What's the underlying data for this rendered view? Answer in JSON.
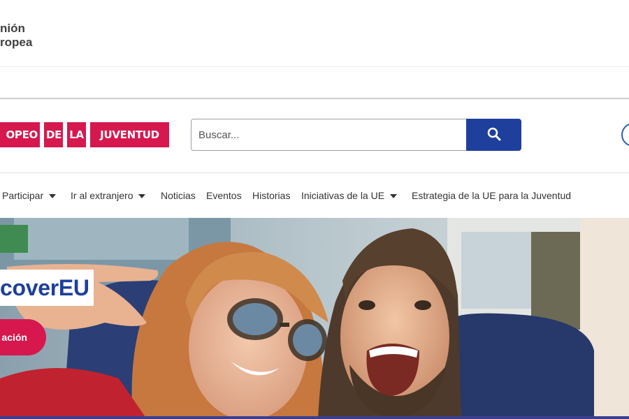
{
  "eu_logo": {
    "line1": "nión",
    "line2": "ropea"
  },
  "brand": {
    "tiles": [
      "OPEO",
      "DE",
      "LA",
      "JUVENTUD"
    ],
    "color": "#d6184e"
  },
  "search": {
    "placeholder": "Buscar...",
    "button_color": "#1e3f9c",
    "icon": "search-icon"
  },
  "nav": {
    "items": [
      {
        "label": "Participar",
        "dropdown": true
      },
      {
        "label": "Ir al extranjero",
        "dropdown": true
      },
      {
        "label": "Noticias",
        "dropdown": false
      },
      {
        "label": "Eventos",
        "dropdown": false
      },
      {
        "label": "Historias",
        "dropdown": false
      },
      {
        "label": "Iniciativas de la UE",
        "dropdown": true
      },
      {
        "label": "Estrategia de la UE para la Juventud",
        "dropdown": false
      }
    ]
  },
  "hero": {
    "title": "coverEU",
    "cta_label": "ación",
    "title_color": "#1e3f9c",
    "cta_color": "#d6184e"
  }
}
